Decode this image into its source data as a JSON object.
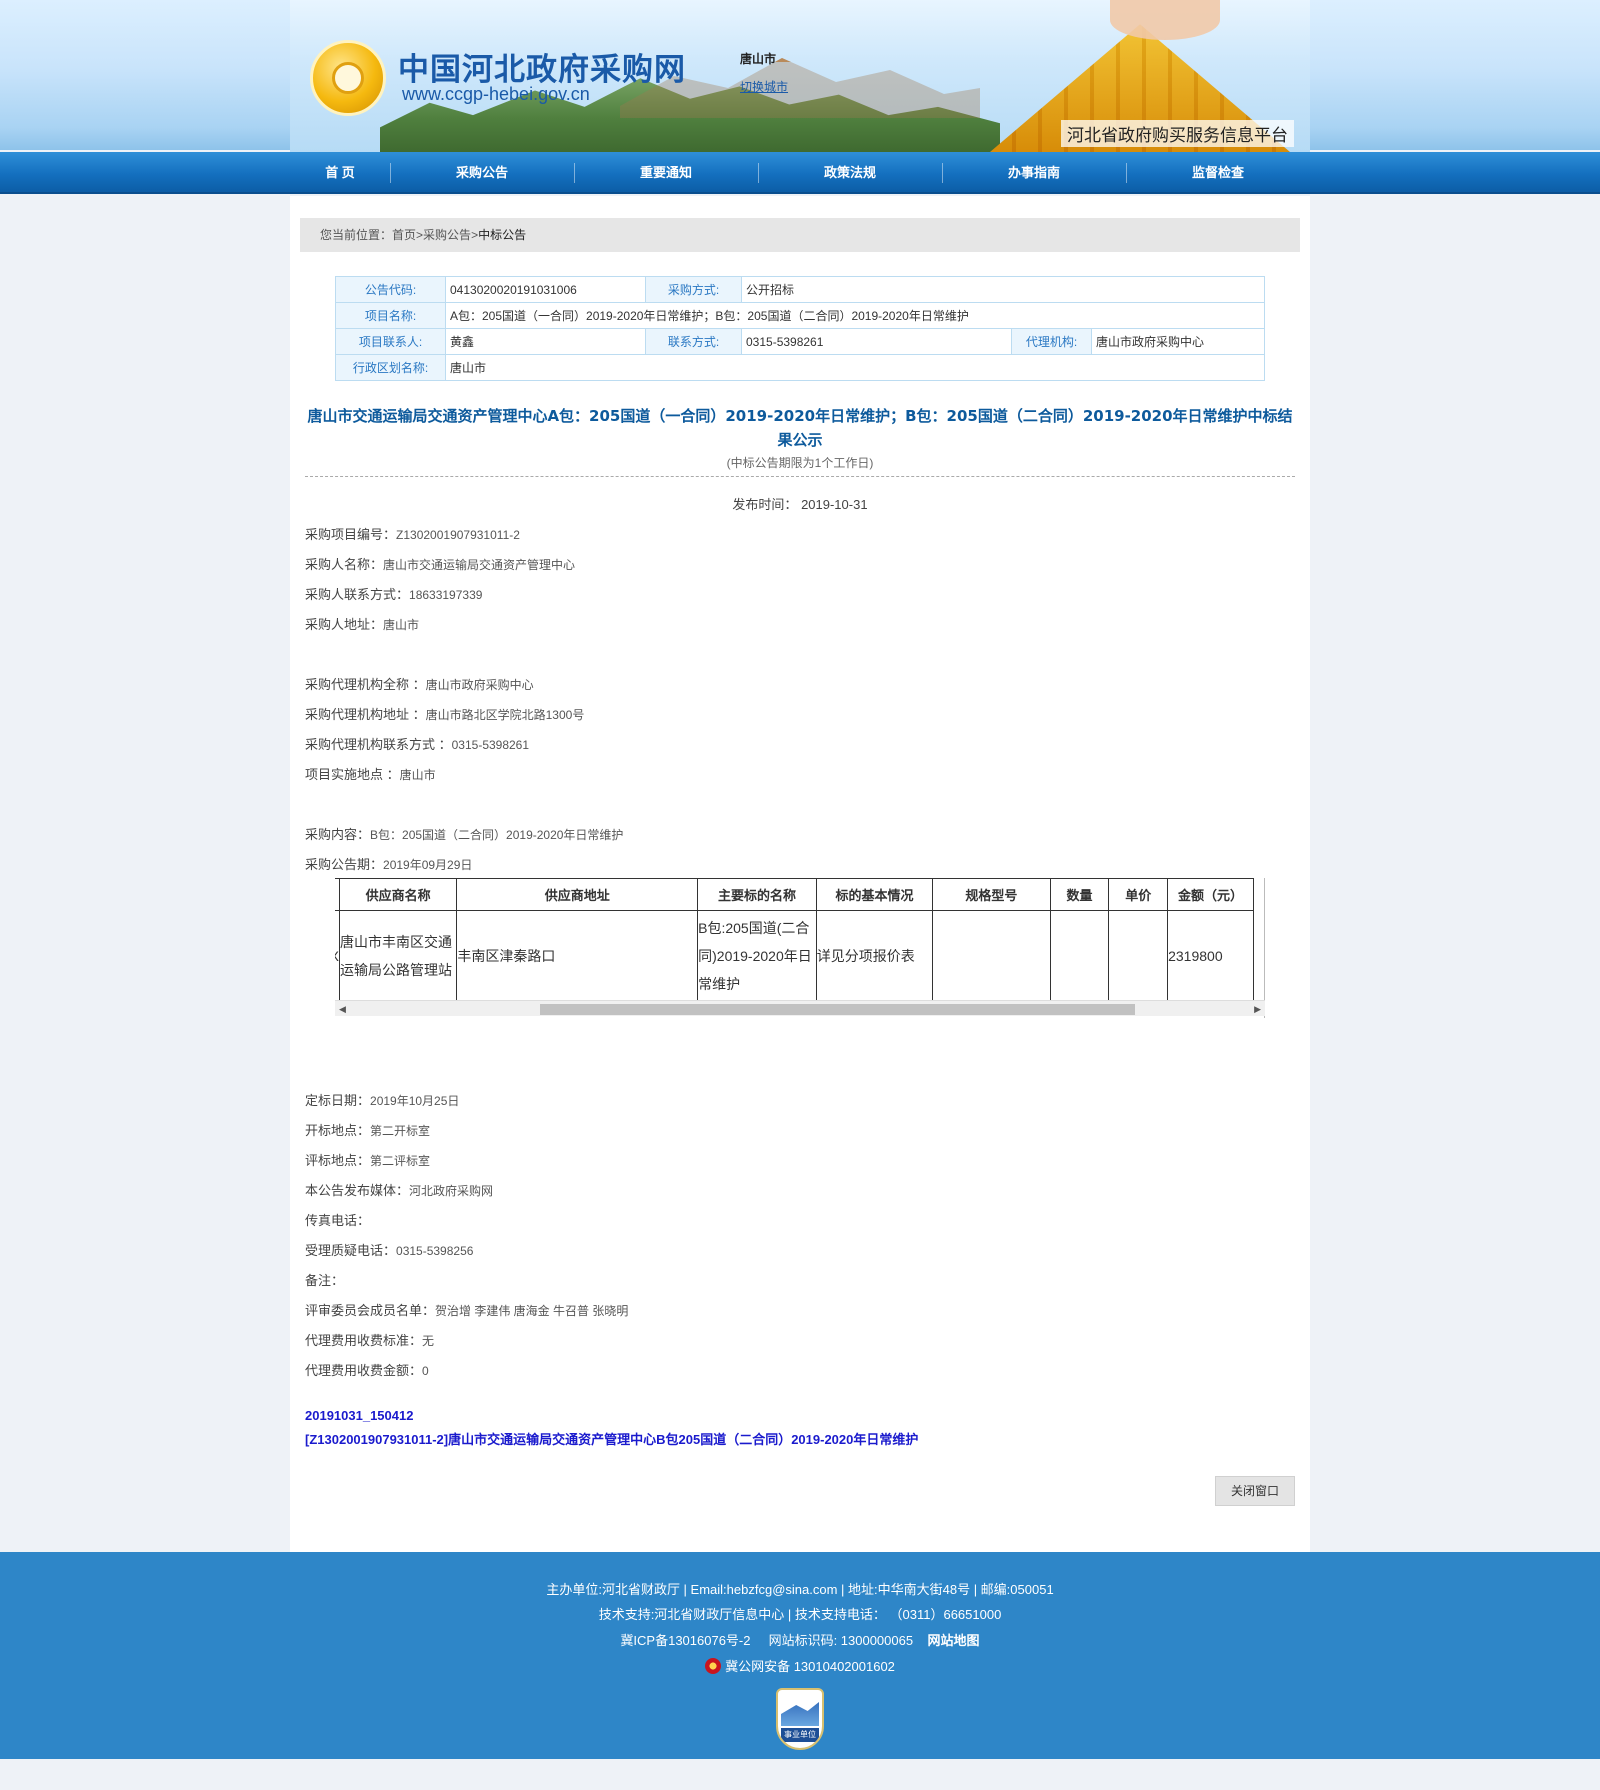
{
  "header": {
    "site_name": "中国河北政府采购网",
    "site_url": "www.ccgp-hebei.gov.cn",
    "city": "唐山市",
    "switch_city": "切换城市",
    "platform": "河北省政府购买服务信息平台"
  },
  "nav": [
    "首 页",
    "采购公告",
    "重要通知",
    "政策法规",
    "办事指南",
    "监督检查"
  ],
  "breadcrumb": {
    "prefix": "您当前位置：",
    "home": "首页",
    "sep": ">",
    "level1": "采购公告",
    "level2": "中标公告"
  },
  "info": {
    "code_label": "公告代码:",
    "code": "0413020020191031006",
    "method_label": "采购方式:",
    "method": "公开招标",
    "project_label": "项目名称:",
    "project": "A包：205国道（一合同）2019-2020年日常维护；B包：205国道（二合同）2019-2020年日常维护",
    "contact_label": "项目联系人:",
    "contact": "黄鑫",
    "phone_label": "联系方式:",
    "phone": "0315-5398261",
    "agency_label": "代理机构:",
    "agency": "唐山市政府采购中心",
    "region_label": "行政区划名称:",
    "region": "唐山市"
  },
  "notice": {
    "title": "唐山市交通运输局交通资产管理中心A包：205国道（一合同）2019-2020年日常维护；B包：205国道（二合同）2019-2020年日常维护中标结果公示",
    "period": "(中标公告期限为1个工作日)",
    "publish_label": "发布时间：",
    "publish_date": "2019-10-31"
  },
  "fields": [
    {
      "label": "采购项目编号：",
      "value": "Z1302001907931011-2"
    },
    {
      "label": "采购人名称：",
      "value": "唐山市交通运输局交通资产管理中心"
    },
    {
      "label": "采购人联系方式：",
      "value": "18633197339"
    },
    {
      "label": "采购人地址：",
      "value": "唐山市"
    },
    {
      "label": "采购代理机构全称 ：",
      "value": "唐山市政府采购中心"
    },
    {
      "label": "采购代理机构地址 ：",
      "value": "唐山市路北区学院北路1300号"
    },
    {
      "label": "采购代理机构联系方式 ：",
      "value": "0315-5398261"
    },
    {
      "label": "项目实施地点 ：",
      "value": "唐山市"
    },
    {
      "label": "采购内容：",
      "value": "B包：205国道（二合同）2019-2020年日常维护"
    },
    {
      "label": "采购公告期：",
      "value": "2019年09月29日"
    }
  ],
  "bid_table": {
    "headers": [
      "供应商名称",
      "供应商地址",
      "主要标的名称",
      "标的基本情况",
      "规格型号",
      "数量",
      "单价",
      "金额（元）"
    ],
    "row": {
      "prefix": "X",
      "supplier": "唐山市丰南区交通运输局公路管理站",
      "address": "丰南区津秦路口",
      "item": "B包:205国道(二合同)2019-2020年日常维护",
      "basic": "详见分项报价表",
      "spec": "",
      "qty": "",
      "price": "",
      "amount": "2319800"
    }
  },
  "fields2": [
    {
      "label": "定标日期：",
      "value": "2019年10月25日"
    },
    {
      "label": "开标地点：",
      "value": "第二开标室"
    },
    {
      "label": "评标地点：",
      "value": "第二评标室"
    },
    {
      "label": "本公告发布媒体：",
      "value": "河北政府采购网"
    },
    {
      "label": "传真电话：",
      "value": ""
    },
    {
      "label": "受理质疑电话：",
      "value": "0315-5398256"
    },
    {
      "label": "备注：",
      "value": ""
    },
    {
      "label": "评审委员会成员名单：",
      "value": "贺治增 李建伟 唐海金 牛召普 张晓明"
    },
    {
      "label": "代理费用收费标准：",
      "value": "无"
    },
    {
      "label": "代理费用收费金额：",
      "value": "0"
    }
  ],
  "links": [
    "20191031_150412",
    "[Z1302001907931011-2]唐山市交通运输局交通资产管理中心B包205国道（二合同）2019-2020年日常维护"
  ],
  "close_button": "关闭窗口",
  "footer": {
    "line1": "主办单位:河北省财政厅 | Email:hebzfcg@sina.com | 地址:中华南大街48号 | 邮编:050051",
    "line2": "技术支持:河北省财政厅信息中心 | 技术支持电话： （0311）66651000",
    "icp": "冀ICP备13016076号-2",
    "site_id": "网站标识码: 1300000065",
    "sitemap": "网站地图",
    "police": "冀公网安备 13010402001602",
    "badge": "事业单位"
  }
}
